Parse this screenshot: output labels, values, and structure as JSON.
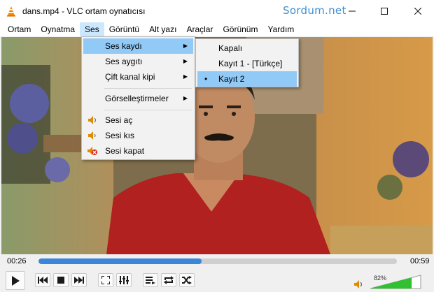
{
  "window": {
    "title": "dans.mp4 - VLC ortam oynatıcısı",
    "watermark": "Sordum.net",
    "controls": {
      "minimize": "minimize-icon",
      "maximize": "maximize-icon",
      "close": "close-icon"
    }
  },
  "menubar": [
    "Ortam",
    "Oynatma",
    "Ses",
    "Görüntü",
    "Alt yazı",
    "Araçlar",
    "Görünüm",
    "Yardım"
  ],
  "audio_menu": {
    "items": [
      {
        "label": "Ses kaydı",
        "submenu": true
      },
      {
        "label": "Ses aygıtı",
        "submenu": true
      },
      {
        "label": "Çift kanal kipi",
        "submenu": true
      },
      {
        "label": "Görselleştirmeler",
        "submenu": true
      },
      {
        "label": "Sesi aç",
        "icon": "volume-up-icon"
      },
      {
        "label": "Sesi kıs",
        "icon": "volume-down-icon"
      },
      {
        "label": "Sesi kapat",
        "icon": "mute-icon"
      }
    ]
  },
  "track_submenu": {
    "items": [
      {
        "label": "Kapalı",
        "selected": false
      },
      {
        "label": "Kayıt 1 - [Türkçe]",
        "selected": false
      },
      {
        "label": "Kayıt 2",
        "selected": true
      }
    ],
    "selected_marker": "•"
  },
  "player": {
    "elapsed": "00:26",
    "total": "00:59",
    "progress_fraction": 0.455,
    "volume_percent": "82%",
    "volume_fraction": 0.82
  },
  "colors": {
    "highlight": "#91c9f7",
    "progress": "#3b86d6",
    "watermark": "#3c8fd4",
    "volume": "#2fc12f"
  }
}
